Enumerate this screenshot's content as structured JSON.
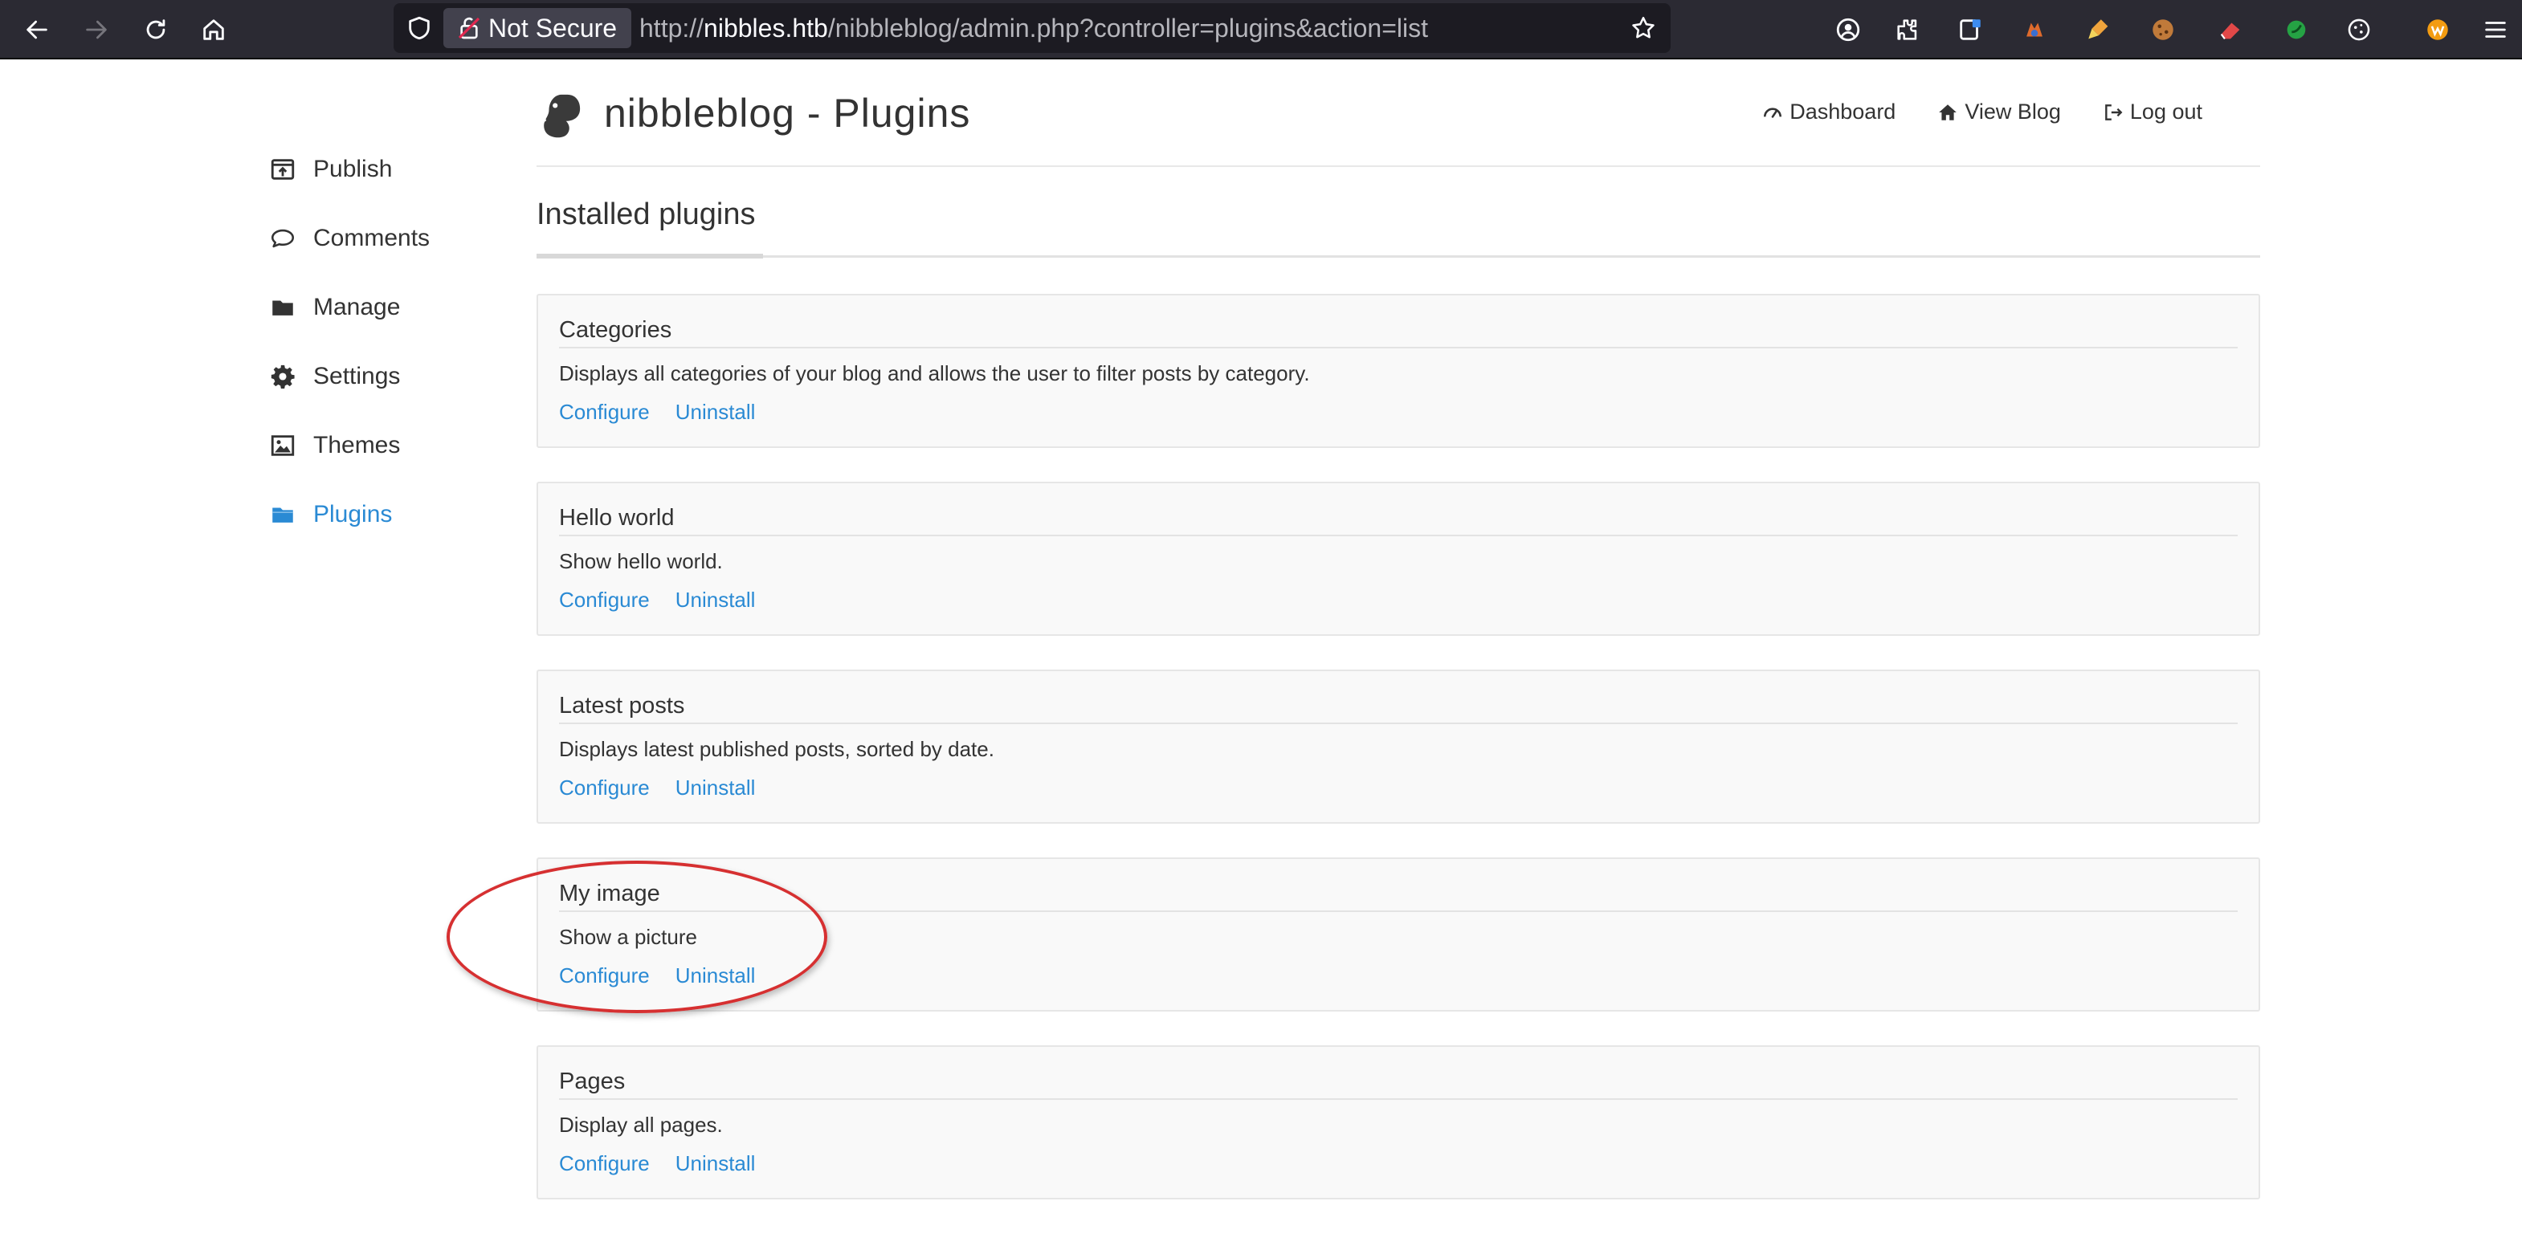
{
  "browser": {
    "security_label": "Not Secure",
    "url_prefix": "http://",
    "url_host": "nibbles.htb",
    "url_path": "/nibbleblog/admin.php?controller=plugins&action=list"
  },
  "sidebar": {
    "items": [
      {
        "label": "Publish",
        "icon": "publish-icon"
      },
      {
        "label": "Comments",
        "icon": "comment-icon"
      },
      {
        "label": "Manage",
        "icon": "folder-icon"
      },
      {
        "label": "Settings",
        "icon": "gear-icon"
      },
      {
        "label": "Themes",
        "icon": "image-icon"
      },
      {
        "label": "Plugins",
        "icon": "folder-open-icon",
        "active": true
      }
    ]
  },
  "header": {
    "title": "nibbleblog - Plugins",
    "nav": {
      "dashboard": "Dashboard",
      "view_blog": "View Blog",
      "logout": "Log out"
    }
  },
  "main": {
    "section_title": "Installed plugins",
    "plugins": [
      {
        "name": "Categories",
        "description": "Displays all categories of your blog and allows the user to filter posts by category.",
        "configure": "Configure",
        "uninstall": "Uninstall"
      },
      {
        "name": "Hello world",
        "description": "Show hello world.",
        "configure": "Configure",
        "uninstall": "Uninstall"
      },
      {
        "name": "Latest posts",
        "description": "Displays latest published posts, sorted by date.",
        "configure": "Configure",
        "uninstall": "Uninstall"
      },
      {
        "name": "My image",
        "description": "Show a picture",
        "configure": "Configure",
        "uninstall": "Uninstall"
      },
      {
        "name": "Pages",
        "description": "Display all pages.",
        "configure": "Configure",
        "uninstall": "Uninstall"
      }
    ]
  },
  "colors": {
    "link": "#2a8ad4",
    "annotation": "#d63031",
    "chrome_bg": "#2b2a33"
  }
}
